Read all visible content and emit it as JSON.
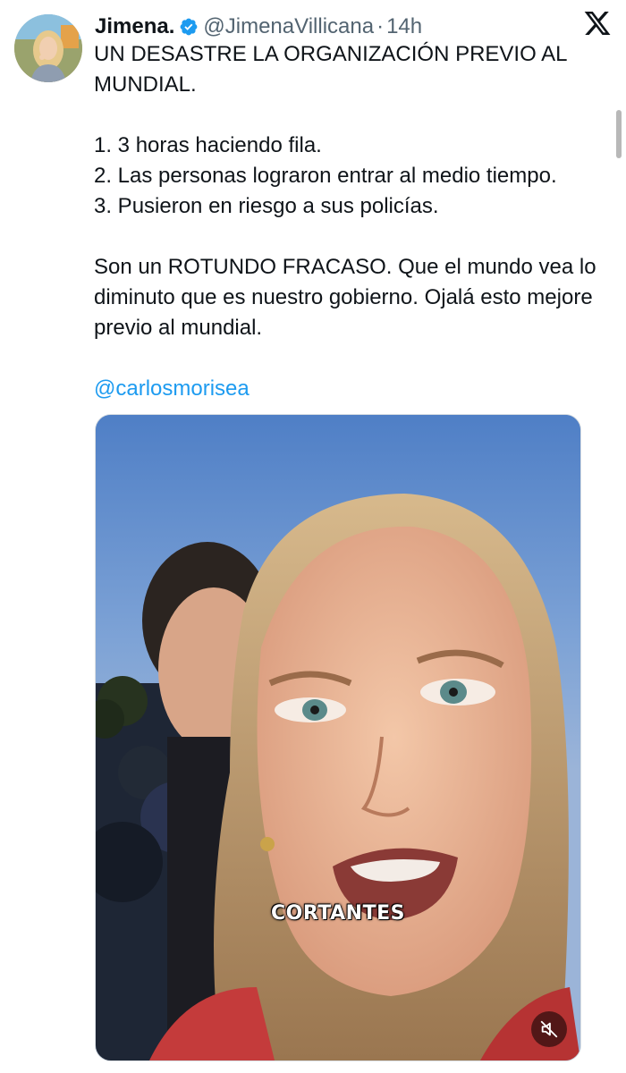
{
  "header": {
    "display_name": "Jimena.",
    "handle": "@JimenaVillicana",
    "separator": "·",
    "time": "14h"
  },
  "tweet": {
    "line1": "UN DESASTRE LA ORGANIZACIÓN PREVIO AL MUNDIAL.",
    "list": [
      "1. 3 horas haciendo fila.",
      "2. Las personas lograron entrar al medio tiempo.",
      "3. Pusieron en riesgo a sus policías."
    ],
    "paragraph": "Son un ROTUNDO FRACASO. Que el mundo vea lo diminuto que es nuestro gobierno. Ojalá esto mejore previo al mundial.",
    "mention": "@carlosmorisea"
  },
  "video": {
    "caption": "CORTANTES",
    "muted": true
  },
  "icons": {
    "verified": "verified-badge-icon",
    "brand": "x-logo-icon",
    "mute": "muted-speaker-icon"
  },
  "colors": {
    "link": "#1d9bf0",
    "verified": "#1d9bf0",
    "secondary_text": "#536471",
    "primary_text": "#0f1419"
  }
}
